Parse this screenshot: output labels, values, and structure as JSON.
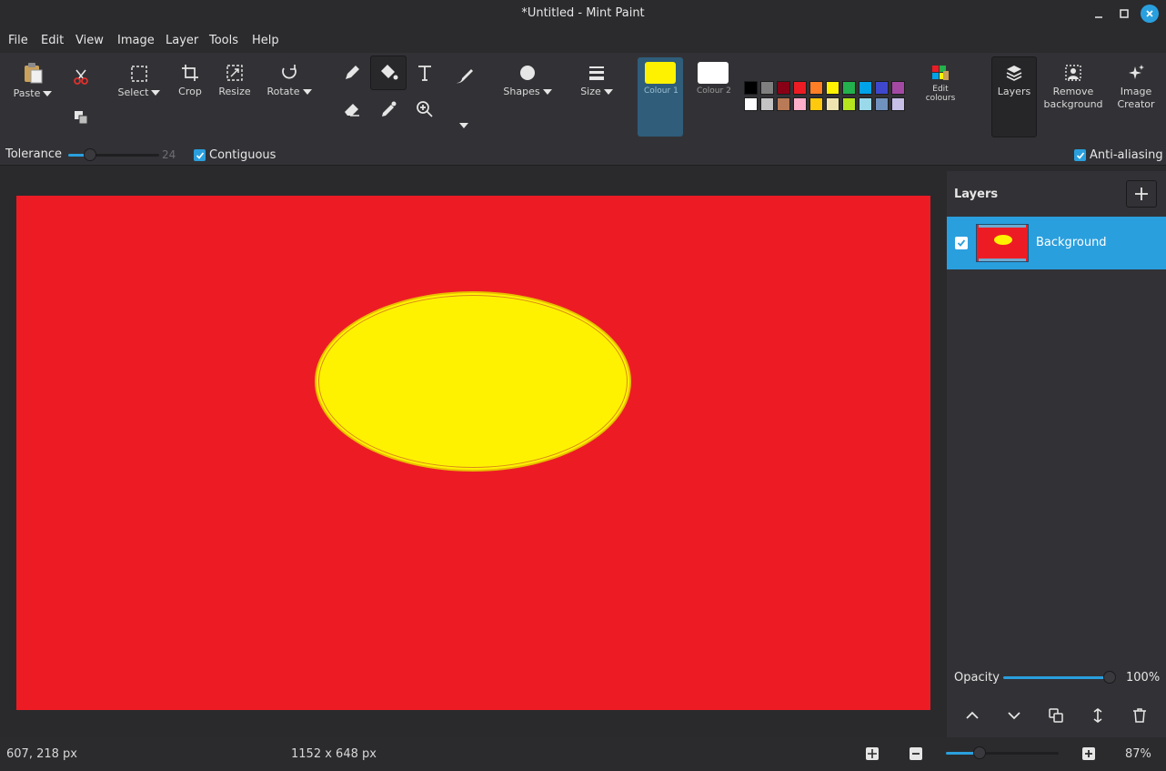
{
  "window": {
    "title": "*Untitled - Mint Paint"
  },
  "menu": [
    "File",
    "Edit",
    "View",
    "Image",
    "Layer",
    "Tools",
    "Help"
  ],
  "toolbar": {
    "paste": "Paste",
    "select": "Select",
    "crop": "Crop",
    "resize": "Resize",
    "rotate": "Rotate",
    "shapes": "Shapes",
    "size": "Size",
    "colour1": "Colour 1",
    "colour2": "Colour 2",
    "edit_colours_line1": "Edit",
    "edit_colours_line2": "colours",
    "layers": "Layers",
    "remove_bg_line1": "Remove",
    "remove_bg_line2": "background",
    "image_creator_line1": "Image",
    "image_creator_line2": "Creator"
  },
  "colors": {
    "colour1": "#fff200",
    "colour2": "#ffffff",
    "palette_row1": [
      "#000000",
      "#7f7f7f",
      "#880015",
      "#ed1c24",
      "#ff7f27",
      "#fff200",
      "#22b14c",
      "#00a2e8",
      "#3f48cc",
      "#a349a4"
    ],
    "palette_row2": [
      "#ffffff",
      "#c3c3c3",
      "#b97a57",
      "#ffaec9",
      "#ffc90e",
      "#efe4b0",
      "#b5e61d",
      "#99d9ea",
      "#7092be",
      "#c8bfe7"
    ],
    "canvas_background": "#ed1c24",
    "ellipse_fill": "#fff200",
    "accent": "#2a9fde"
  },
  "options": {
    "tolerance_label": "Tolerance",
    "tolerance_value": "24",
    "tolerance_fraction": 0.24,
    "contiguous": "Contiguous",
    "anti_aliasing": "Anti-aliasing"
  },
  "layers_panel": {
    "title": "Layers",
    "layers": [
      {
        "name": "Background",
        "visible": true
      }
    ],
    "opacity_label": "Opacity",
    "opacity_value": "100%",
    "opacity_fraction": 1.0
  },
  "status": {
    "cursor_position": "607, 218 px",
    "image_size": "1152 x 648 px",
    "zoom": "87%",
    "zoom_fraction": 0.3
  }
}
